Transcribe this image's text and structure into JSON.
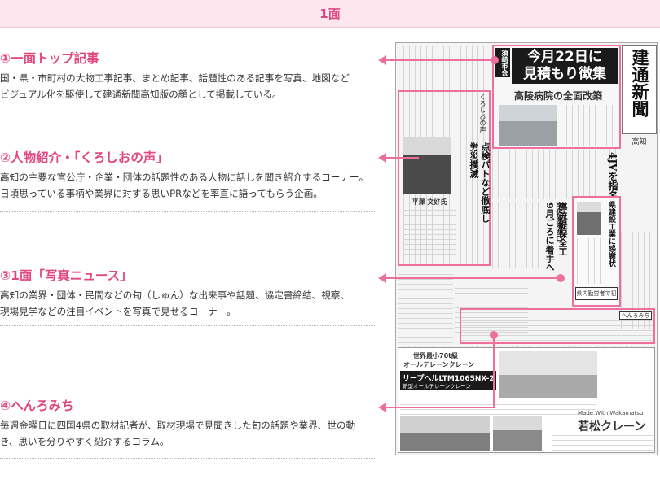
{
  "header": {
    "title": "1面"
  },
  "sections": [
    {
      "title": "①一面トップ記事",
      "lines": [
        "国・県・市町村の大物工事記事、まとめ記事、話題性のある記事を写真、地図など",
        "ビジュアル化を駆使して建通新聞高知版の顔として掲載している。"
      ]
    },
    {
      "title": "②人物紹介・「くろしおの声」",
      "lines": [
        "高知の主要な官公庁・企業・団体の話題性のある人物に話しを聞き紹介するコーナー。",
        "日頃思っている事柄や業界に対する思いPRなどを率直に語ってもらう企画。"
      ]
    },
    {
      "title": "③1面「写真ニュース」",
      "lines": [
        "高知の業界・団体・民間などの旬（しゅん）な出来事や話題、協定書締結、視察、",
        "現場見学などの注目イベントを写真で見せるコーナー。"
      ]
    },
    {
      "title": "④へんろみち",
      "lines": [
        "毎週金曜日に四国4県の取材記者が、取材現場で見聞きした旬の話題や業界、世の動",
        "き、思いを分りやすく紹介するコラム。"
      ]
    }
  ],
  "newspaper": {
    "masthead": "建通新聞",
    "edition": "高知",
    "top_kicker": "須崎市会",
    "top_headline_1": "今月22日に",
    "top_headline_2": "見積もり徴集",
    "top_subhead": "高陵病院の全面改築",
    "vertical_headline_1": "4JVを指名",
    "column_title": "くろしおの声",
    "column_headline_1": "点検パトなど徹底し",
    "column_headline_2": "労災撲滅",
    "column_person": "平澤 文好氏",
    "photo_news_headline": "県建設工業に感謝状",
    "photo_news_caption": "県内勤労者で初",
    "mid_kicker": "宇佐漁港西口",
    "mid_headline_1": "導流堤保全工",
    "mid_headline_2": "9月ごろに着手へ",
    "henro_label": "へんろみち",
    "ad_catch": "世界最小70t級",
    "ad_catch_2": "オールテレーンクレーン",
    "ad_model": "リープヘルLTM1065NX-2",
    "ad_model_sub": "新型オールテレーンクレーン",
    "ad_made_with": "Made With Wakamatsu",
    "ad_company": "若松クレーン"
  },
  "colors": {
    "accent": "#e2477f",
    "annotation": "#ee6f9d",
    "header_bg": "#fde6ee"
  }
}
